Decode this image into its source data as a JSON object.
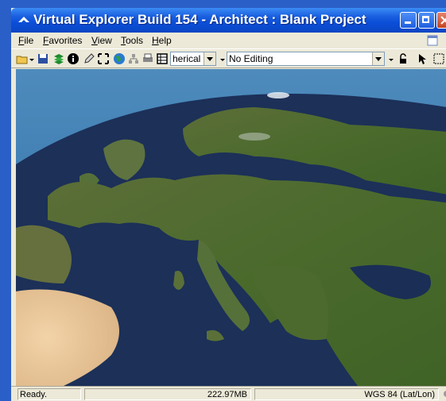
{
  "window": {
    "title": "Virtual Explorer Build 154 - Architect : Blank Project"
  },
  "menu": {
    "items": [
      "File",
      "Favorites",
      "View",
      "Tools",
      "Help"
    ]
  },
  "toolbar": {
    "projection_value": "herical",
    "editing_value": "No Editing"
  },
  "status": {
    "ready_text": "Ready.",
    "memory_text": "222.97MB",
    "crs_text": "WGS 84 (Lat/Lon)"
  },
  "colors": {
    "title_blue": "#0b4ed8",
    "ocean": "#1c3058",
    "land_green": "#4a6a2c"
  }
}
